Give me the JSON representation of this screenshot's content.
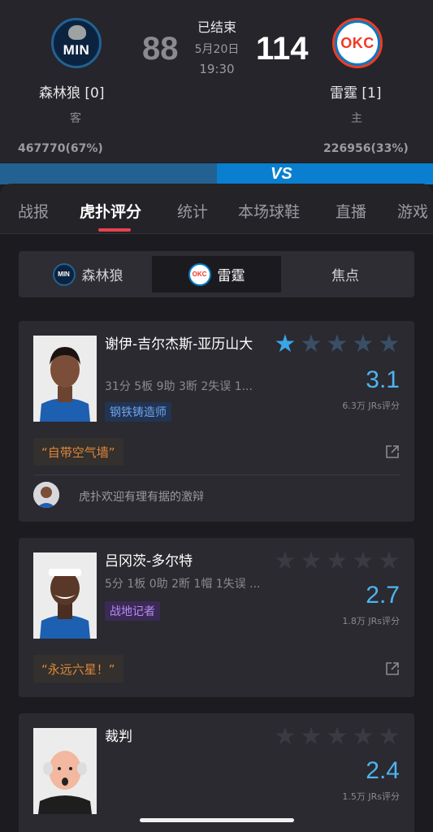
{
  "header": {
    "away": {
      "logo": "MIN",
      "name": "森林狼 [0]",
      "side": "客",
      "score": "88",
      "votes": "467770(67%)"
    },
    "home": {
      "logo": "OKC",
      "name": "雷霆 [1]",
      "side": "主",
      "score": "114",
      "votes": "226956(33%)"
    },
    "status": "已结束",
    "date": "5月20日",
    "time": "19:30",
    "vs": "VS"
  },
  "tabs": [
    "战报",
    "虎扑评分",
    "统计",
    "本场球鞋",
    "直播",
    "游戏"
  ],
  "active_tab": "虎扑评分",
  "team_switch": {
    "items": [
      {
        "label": "森林狼",
        "logo": "MIN"
      },
      {
        "label": "雷霆",
        "logo": "OKC"
      },
      {
        "label": "焦点"
      }
    ],
    "active": "雷霆"
  },
  "players": [
    {
      "name": "谢伊-吉尔杰斯-亚历山大",
      "stats": "31分 5板 9助 3断 2失误 1...",
      "badge": "钢铁铸造师",
      "rating": "3.1",
      "stars": 1,
      "count": "6.3万 JRs评分",
      "quote": "“自带空气墙”",
      "comment": "虎扑欢迎有理有据的激辩"
    },
    {
      "name": "吕冈茨-多尔特",
      "stats": "5分 1板 0助 2断 1帽 1失误 ...",
      "badge": "战地记者",
      "rating": "2.7",
      "stars": 0,
      "count": "1.8万 JRs评分",
      "quote": "“永远六星！”"
    },
    {
      "name": "裁判",
      "rating": "2.4",
      "stars": 0,
      "count": "1.5万 JRs评分"
    }
  ],
  "colors": {
    "accent": "#e8424d",
    "rating": "#4fb3f0",
    "quote": "#e0873a"
  }
}
